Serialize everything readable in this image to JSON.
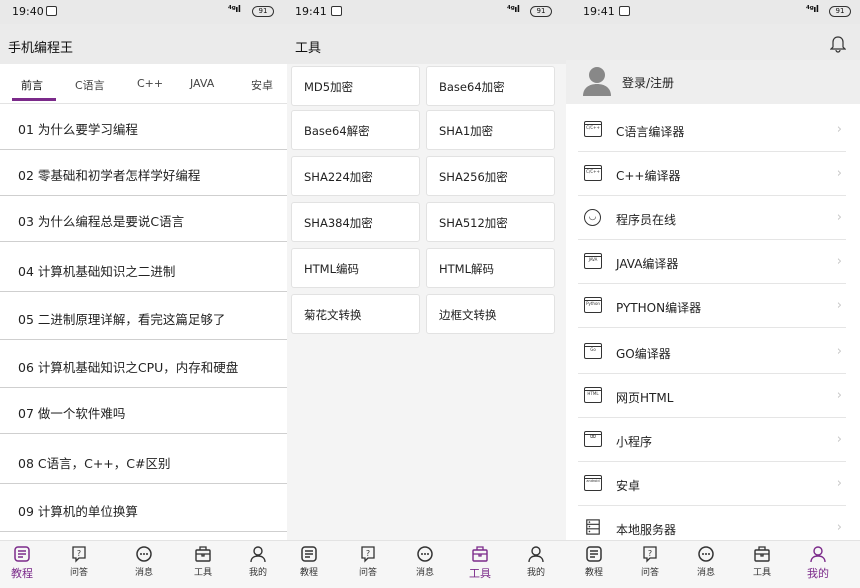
{
  "panel1": {
    "status": {
      "time": "19:40",
      "battery": "91"
    },
    "title": "手机编程王",
    "tabs": [
      "前言",
      "C语言",
      "C++",
      "JAVA",
      "安卓"
    ],
    "lessons": [
      "01 为什么要学习编程",
      "02 零基础和初学者怎样学好编程",
      "03 为什么编程总是要说C语言",
      "04 计算机基础知识之二进制",
      "05 二进制原理详解，看完这篇足够了",
      "06 计算机基础知识之CPU，内存和硬盘",
      "07 做一个软件难吗",
      "08 C语言，C++，C#区别",
      "09 计算机的单位换算"
    ]
  },
  "panel2": {
    "status": {
      "time": "19:41",
      "battery": "91"
    },
    "title": "工具",
    "tools": [
      "MD5加密",
      "Base64加密",
      "Base64解密",
      "SHA1加密",
      "SHA224加密",
      "SHA256加密",
      "SHA384加密",
      "SHA512加密",
      "HTML编码",
      "HTML解码",
      "菊花文转换",
      "边框文转换"
    ]
  },
  "panel3": {
    "status": {
      "time": "19:41",
      "battery": "91"
    },
    "login_label": "登录/注册",
    "menu": [
      {
        "label": "C语言编译器",
        "icon": "c-compiler-icon",
        "badge": "C/C++"
      },
      {
        "label": "C++编译器",
        "icon": "cpp-compiler-icon",
        "badge": "C/C++"
      },
      {
        "label": "程序员在线",
        "icon": "online-icon",
        "badge": ""
      },
      {
        "label": "JAVA编译器",
        "icon": "java-compiler-icon",
        "badge": "JAVA"
      },
      {
        "label": "PYTHON编译器",
        "icon": "python-compiler-icon",
        "badge": "Python"
      },
      {
        "label": "GO编译器",
        "icon": "go-compiler-icon",
        "badge": "Go"
      },
      {
        "label": "网页HTML",
        "icon": "html-icon",
        "badge": "HTML"
      },
      {
        "label": "小程序",
        "icon": "mini-program-icon",
        "badge": "∞"
      },
      {
        "label": "安卓",
        "icon": "android-icon",
        "badge": "android"
      },
      {
        "label": "本地服务器",
        "icon": "server-icon",
        "badge": ""
      }
    ]
  },
  "nav": [
    "教程",
    "问答",
    "消息",
    "工具",
    "我的"
  ],
  "colors": {
    "accent": "#7b2a8a",
    "appbar": "#ebebeb",
    "statusbar": "#e9e9e9"
  }
}
